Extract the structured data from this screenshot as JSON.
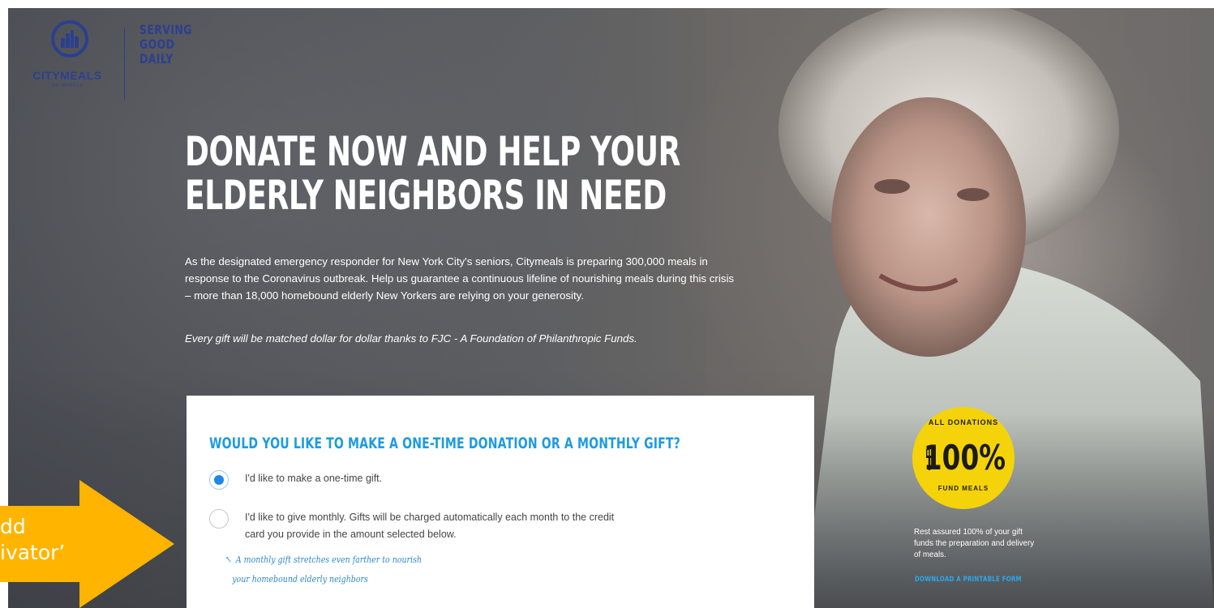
{
  "brand": {
    "logo_name": "CITYMEALS",
    "logo_sub": "ON WHEELS",
    "tagline": [
      "SERVING",
      "GOOD",
      "DAILY"
    ]
  },
  "hero": {
    "headline": [
      "DONATE NOW AND HELP YOUR",
      "ELDERLY NEIGHBORS IN NEED"
    ],
    "intro": "As the designated emergency responder for New York City's seniors, Citymeals is preparing 300,000 meals in response to the Coronavirus outbreak. Help us guarantee a continuous lifeline of nourishing meals during this crisis – more than 18,000 homebound elderly New Yorkers are relying on your generosity.",
    "match": "Every gift will be matched dollar for dollar thanks to FJC - A Foundation of Philanthropic Funds."
  },
  "form": {
    "question": "WOULD YOU LIKE TO MAKE A ONE-TIME DONATION OR A MONTHLY GIFT?",
    "options": [
      {
        "label": "I'd like to make a one-time gift.",
        "selected": true
      },
      {
        "label": "I'd like to give monthly. Gifts will be charged automatically each month to the credit card you provide in the amount selected below.",
        "selected": false
      }
    ],
    "note": [
      "A monthly gift stretches even farther to nourish",
      "your homebound elderly neighbors"
    ]
  },
  "badge": {
    "top": "ALL DONATIONS",
    "percent": "100%",
    "bottom": "FUND MEALS",
    "color": "#f5d30a"
  },
  "sidebar": {
    "text": "Rest assured 100% of your gift funds the preparation and delivery of meals.",
    "link": "DOWNLOAD A PRINTABLE FORM"
  },
  "annotation": {
    "lines": [
      "dd",
      "ivator’"
    ],
    "color": "#ffb400"
  },
  "colors": {
    "accent": "#1e9be0",
    "brand": "#2c3f8f",
    "radio_selected": "#1e88e5"
  }
}
